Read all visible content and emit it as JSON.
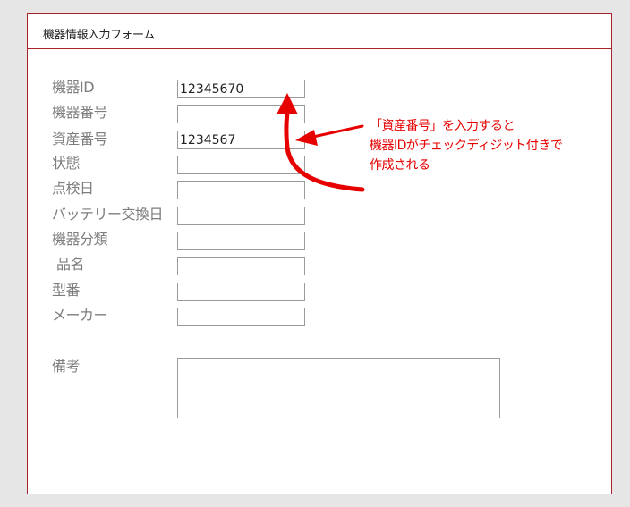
{
  "form": {
    "title": "機器情報入力フォーム",
    "fields": [
      {
        "label": "機器ID",
        "value": "12345670"
      },
      {
        "label": "機器番号",
        "value": ""
      },
      {
        "label": "資産番号",
        "value": "1234567"
      },
      {
        "label": "状態",
        "value": ""
      },
      {
        "label": "点検日",
        "value": ""
      },
      {
        "label": "バッテリー交換日",
        "value": ""
      },
      {
        "label": "機器分類",
        "value": ""
      },
      {
        "label": "品名",
        "value": ""
      },
      {
        "label": "型番",
        "value": ""
      },
      {
        "label": "メーカー",
        "value": ""
      }
    ],
    "notes": {
      "label": "備考",
      "value": ""
    }
  },
  "annotation": {
    "lines": [
      "「資産番号」を入力すると",
      "機器IDがチェックディジット付きで",
      "作成される"
    ],
    "color": "#e60000"
  },
  "colors": {
    "frame_border": "#a6232c",
    "label_text": "#7d7d7d",
    "background": "#e6e6e6"
  }
}
